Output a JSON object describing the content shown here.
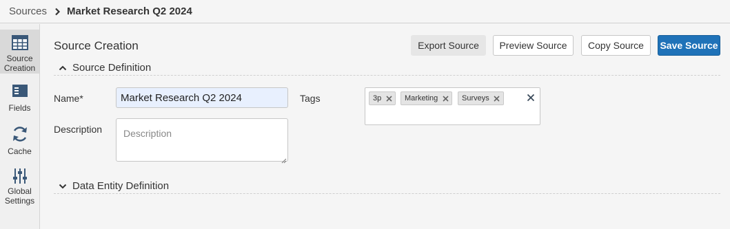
{
  "breadcrumb": {
    "root": "Sources",
    "current": "Market Research Q2 2024"
  },
  "sidenav": {
    "items": [
      {
        "label": "Source Creation",
        "icon": "table-icon",
        "active": true
      },
      {
        "label": "Fields",
        "icon": "fields-icon",
        "active": false
      },
      {
        "label": "Cache",
        "icon": "refresh-icon",
        "active": false
      },
      {
        "label": "Global Settings",
        "icon": "sliders-icon",
        "active": false
      }
    ]
  },
  "main": {
    "title": "Source Creation",
    "buttons": {
      "export": "Export Source",
      "preview": "Preview Source",
      "copy": "Copy Source",
      "save": "Save Source"
    },
    "sections": {
      "definition": "Source Definition",
      "entity": "Data Entity Definition"
    },
    "form": {
      "name_label": "Name*",
      "name_value": "Market Research Q2 2024",
      "description_label": "Description",
      "description_placeholder": "Description",
      "tags_label": "Tags",
      "tags": [
        "3p",
        "Marketing",
        "Surveys"
      ]
    }
  },
  "colors": {
    "primary": "#1f72b8",
    "autofill": "#e8f0fe",
    "background": "#f5f5f5"
  }
}
